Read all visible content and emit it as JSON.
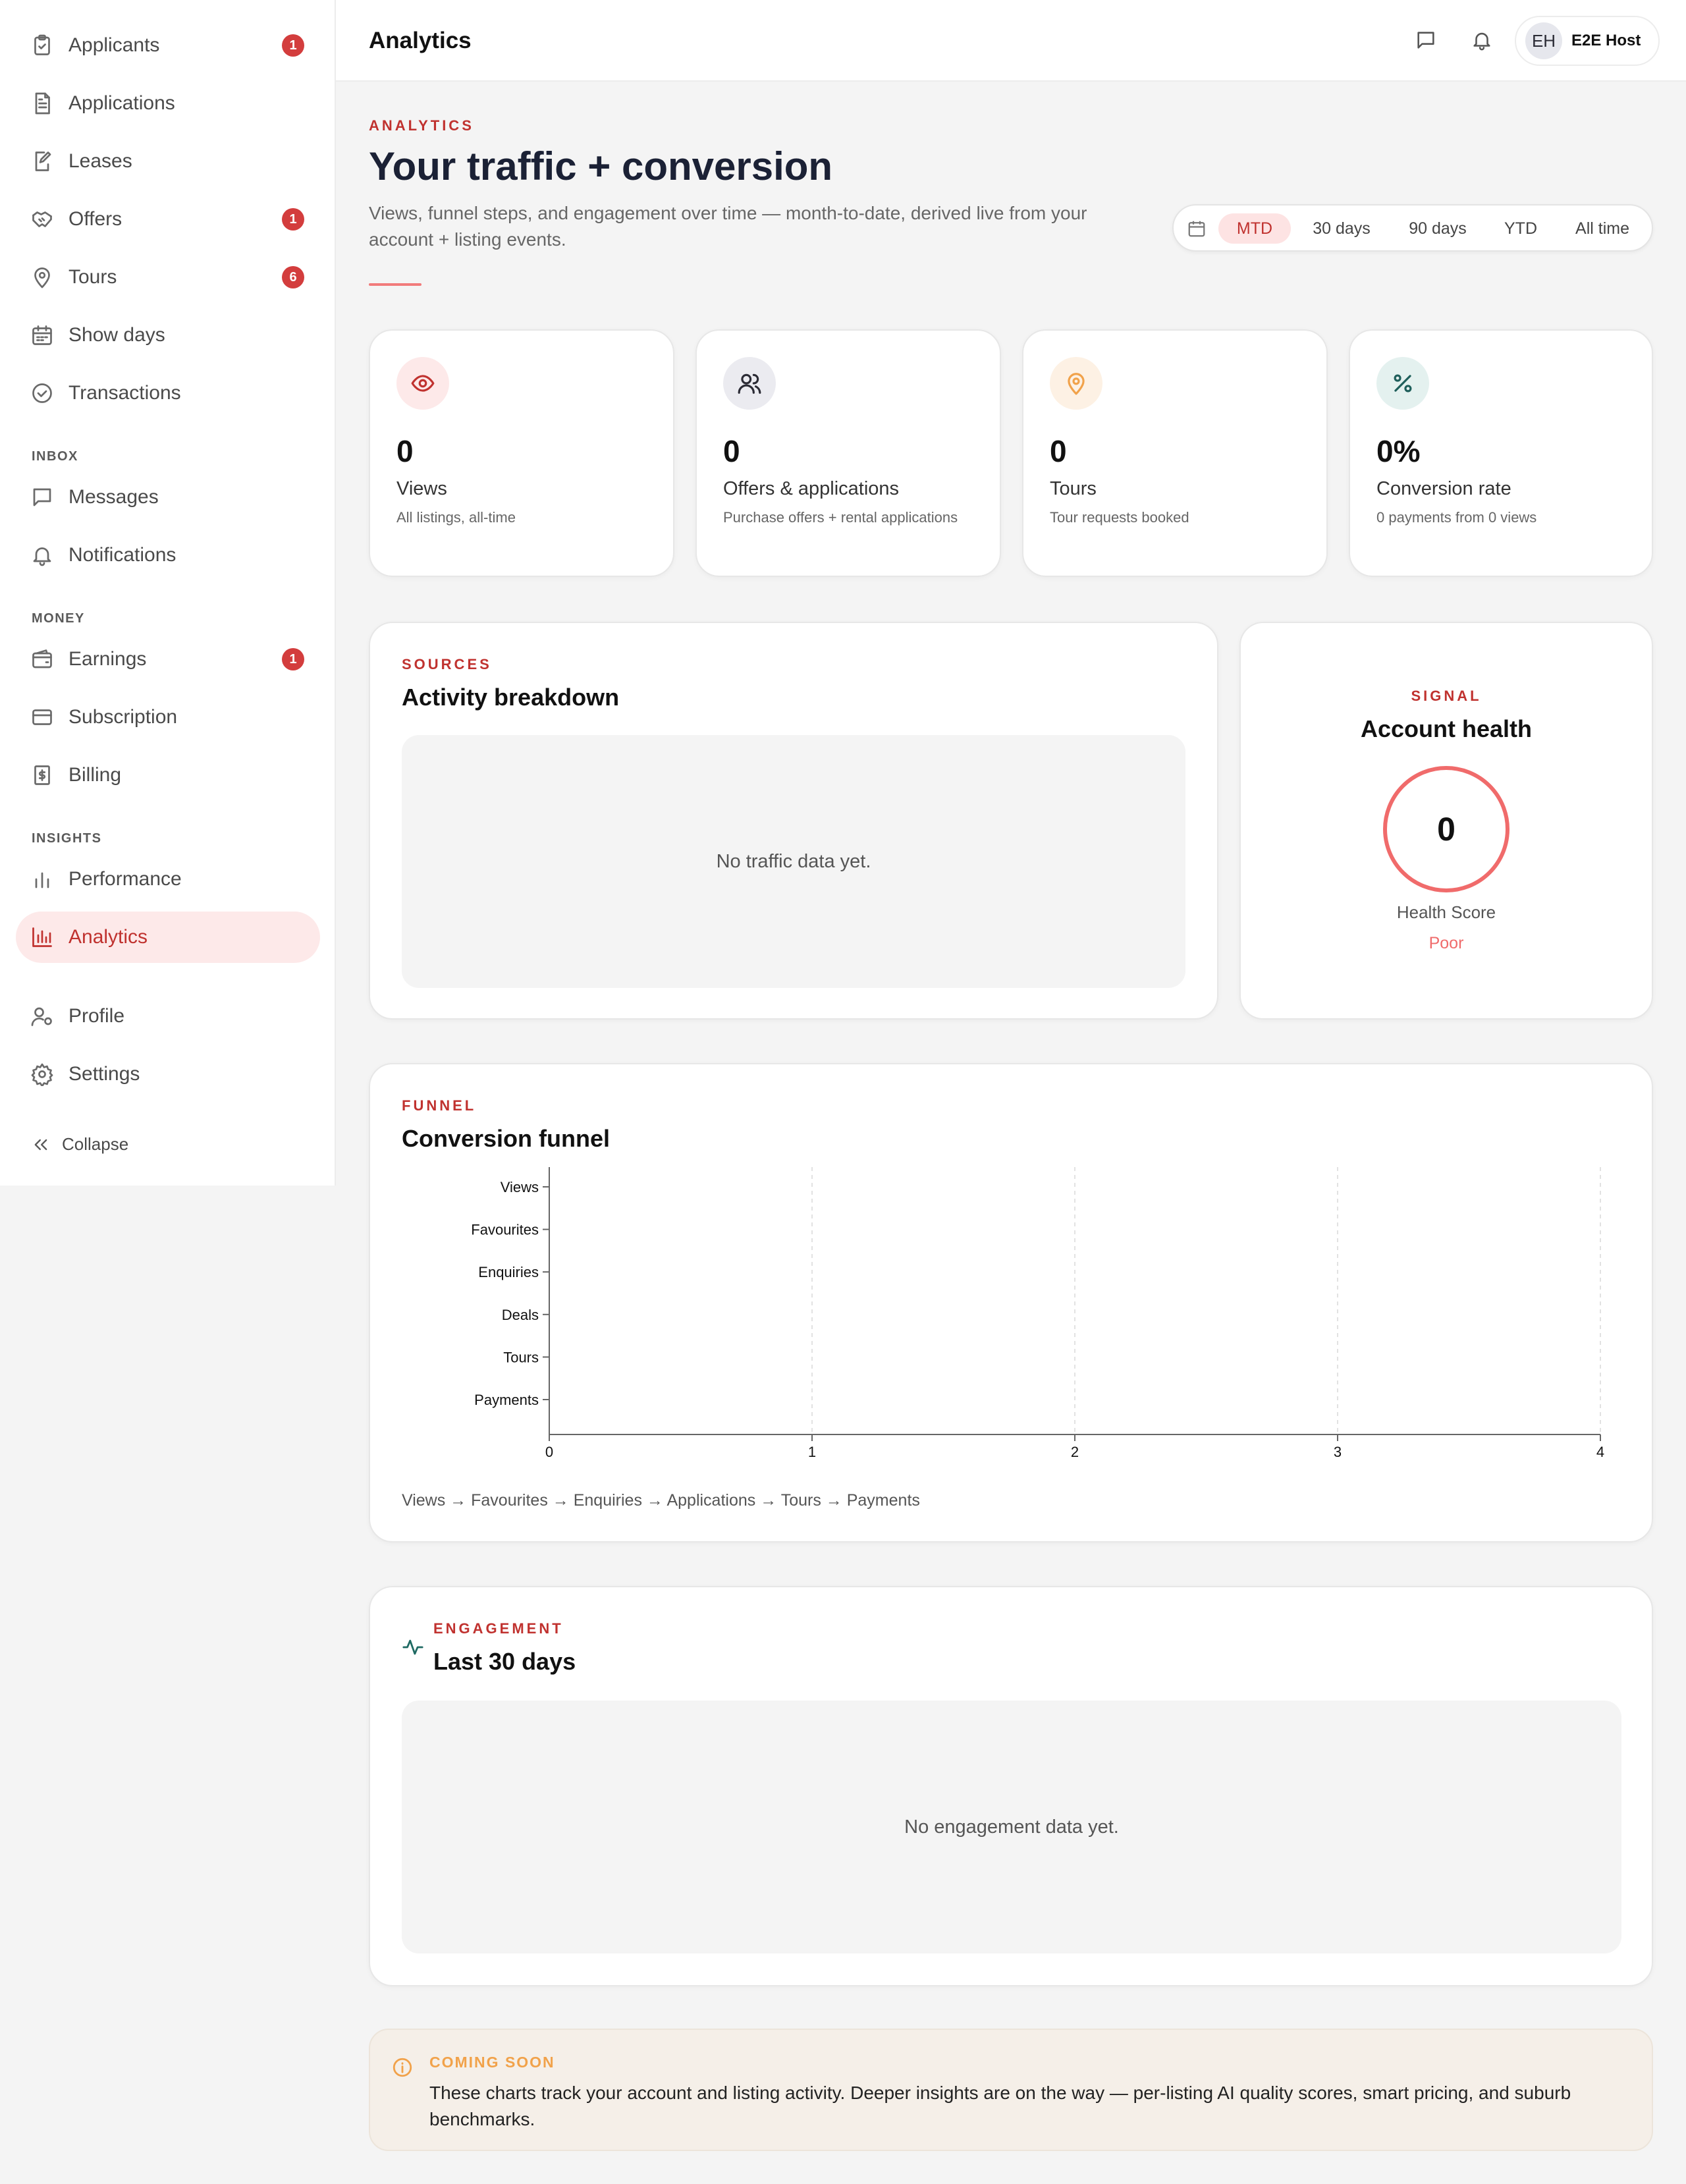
{
  "sidebar": {
    "items": [
      {
        "label": "Applicants",
        "icon": "clipboard-icon",
        "badge": "1"
      },
      {
        "label": "Applications",
        "icon": "document-icon",
        "badge": ""
      },
      {
        "label": "Leases",
        "icon": "pen-document-icon",
        "badge": ""
      },
      {
        "label": "Offers",
        "icon": "handshake-icon",
        "badge": "1"
      },
      {
        "label": "Tours",
        "icon": "map-pin-icon",
        "badge": "6"
      },
      {
        "label": "Show days",
        "icon": "calendar-icon",
        "badge": ""
      },
      {
        "label": "Transactions",
        "icon": "check-badge-icon",
        "badge": ""
      }
    ],
    "inbox_title": "INBOX",
    "inbox": [
      {
        "label": "Messages",
        "icon": "chat-icon"
      },
      {
        "label": "Notifications",
        "icon": "bell-icon"
      }
    ],
    "money_title": "MONEY",
    "money": [
      {
        "label": "Earnings",
        "icon": "wallet-icon",
        "badge": "1"
      },
      {
        "label": "Subscription",
        "icon": "credit-card-icon"
      },
      {
        "label": "Billing",
        "icon": "receipt-icon"
      }
    ],
    "insights_title": "INSIGHTS",
    "insights": [
      {
        "label": "Performance",
        "icon": "bar-chart-icon"
      },
      {
        "label": "Analytics",
        "icon": "analytics-chart-icon",
        "active": true
      }
    ],
    "bottom": [
      {
        "label": "Profile",
        "icon": "user-settings-icon"
      },
      {
        "label": "Settings",
        "icon": "gear-icon"
      }
    ],
    "collapse_label": "Collapse"
  },
  "topbar": {
    "title": "Analytics",
    "user_initials": "EH",
    "user_name": "E2E Host"
  },
  "header": {
    "eyebrow": "ANALYTICS",
    "title": "Your traffic + conversion",
    "subtitle": "Views, funnel steps, and engagement over time — month-to-date, derived live from your account + listing events."
  },
  "range": {
    "options": [
      "MTD",
      "30 days",
      "90 days",
      "YTD",
      "All time"
    ],
    "selected": "MTD"
  },
  "stats": [
    {
      "value": "0",
      "label": "Views",
      "sub": "All listings, all-time",
      "icon": "eye-icon",
      "color": "#c0322f",
      "bg": "#fde9e9"
    },
    {
      "value": "0",
      "label": "Offers & applications",
      "sub": "Purchase offers + rental applications",
      "icon": "users-icon",
      "color": "#2b2b35",
      "bg": "#ebebf0"
    },
    {
      "value": "0",
      "label": "Tours",
      "sub": "Tour requests booked",
      "icon": "map-pin-icon",
      "color": "#f1a24a",
      "bg": "#fdf1e4"
    },
    {
      "value": "0%",
      "label": "Conversion rate",
      "sub": "0 payments from 0 views",
      "icon": "percent-icon",
      "color": "#1f5f5b",
      "bg": "#e4f1ef"
    }
  ],
  "sources": {
    "eyebrow": "SOURCES",
    "title": "Activity breakdown",
    "empty": "No traffic data yet."
  },
  "health": {
    "eyebrow": "SIGNAL",
    "title": "Account health",
    "score": "0",
    "score_label": "Health Score",
    "rating": "Poor"
  },
  "funnel": {
    "eyebrow": "FUNNEL",
    "title": "Conversion funnel",
    "caption": "Views → Favourites → Enquiries → Applications → Tours → Payments"
  },
  "chart_data": {
    "type": "bar",
    "orientation": "horizontal",
    "categories": [
      "Views",
      "Favourites",
      "Enquiries",
      "Deals",
      "Tours",
      "Payments"
    ],
    "values": [
      0,
      0,
      0,
      0,
      0,
      0
    ],
    "x_ticks": [
      "0",
      "1",
      "2",
      "3",
      "4"
    ],
    "xlim": [
      0,
      4
    ],
    "grid": "vertical dashed",
    "title": "",
    "xlabel": "",
    "ylabel": ""
  },
  "engagement": {
    "eyebrow": "ENGAGEMENT",
    "title": "Last 30 days",
    "empty": "No engagement data yet."
  },
  "notice": {
    "title": "COMING SOON",
    "text": "These charts track your account and listing activity. Deeper insights are on the way — per-listing AI quality scores, smart pricing, and suburb benchmarks."
  },
  "colors": {
    "accent": "#c0322f",
    "accent_soft": "#fde9e9",
    "health_ring": "#f06b6b",
    "warning": "#f1a24a"
  }
}
